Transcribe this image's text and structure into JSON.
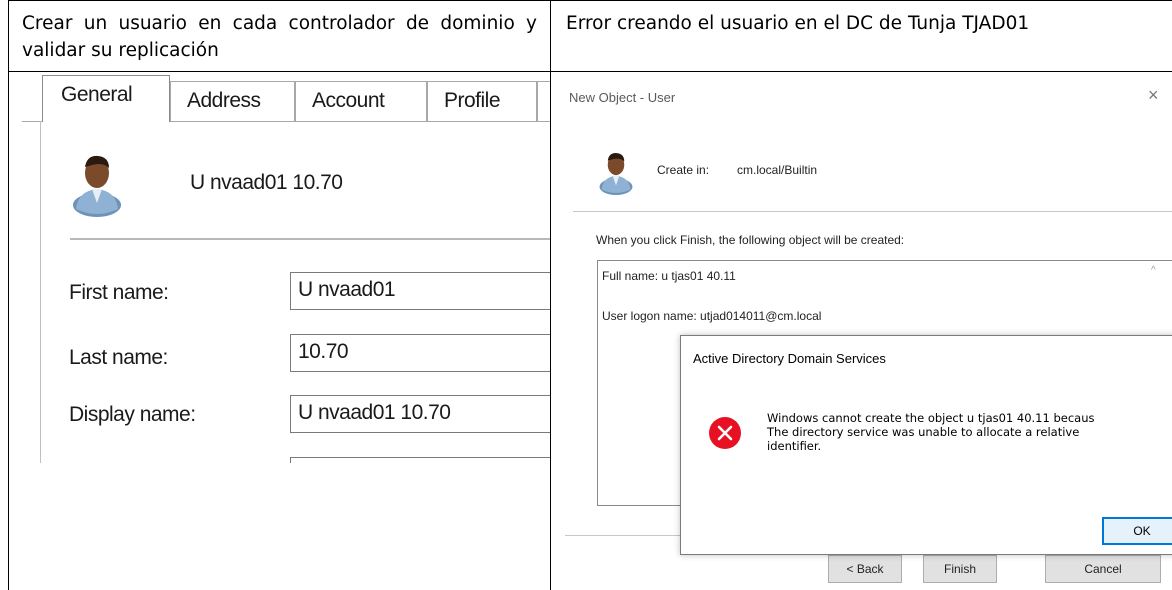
{
  "table": {
    "left_header": "Crear un usuario en cada controlador de dominio y validar su replicación",
    "right_header": "Error creando el usuario en el DC de Tunja TJAD01"
  },
  "properties_dialog": {
    "tabs": [
      "General",
      "Address",
      "Account",
      "Profile"
    ],
    "display_name_heading": "U nvaad01 10.70",
    "fields": [
      {
        "label": "First name:",
        "value": "U nvaad01"
      },
      {
        "label": "Last name:",
        "value": "10.70"
      },
      {
        "label": "Display name:",
        "value": "U nvaad01 10.70"
      }
    ]
  },
  "new_object_dialog": {
    "title": "New Object - User",
    "close_glyph": "×",
    "create_in_label": "Create in:",
    "create_in_value": "cm.local/Builtin",
    "info_text": "When you click Finish, the following object will be created:",
    "summary": {
      "full_name": "Full name: u tjas01 40.11",
      "logon_name": "User logon name: utjad014011@cm.local",
      "scroll_glyph": "^"
    },
    "buttons": {
      "back": "< Back",
      "finish": "Finish",
      "cancel": "Cancel"
    }
  },
  "error_dialog": {
    "title": "Active Directory Domain Services",
    "message": "Windows cannot create the object u tjas01 40.11 becaus\nThe directory service was unable to allocate a relative\nidentifier.",
    "ok_label": "OK",
    "icon": "error-icon",
    "icon_color": "#e81123"
  }
}
